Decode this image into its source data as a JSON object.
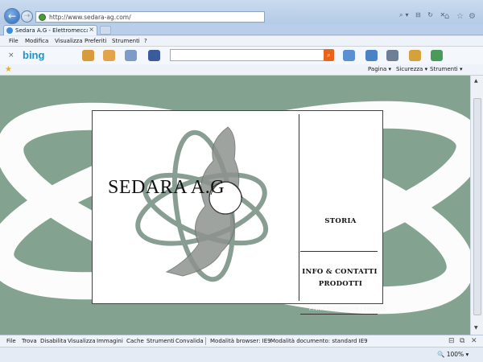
{
  "browser": {
    "url": "http://www.sedara-ag.com/",
    "tab_title": "Sedara A.G - Elettromeccan...",
    "tab_close": "×",
    "back_glyph": "←",
    "forward_glyph": "→",
    "addr_icons": "⌕▾ ⊟ ↻ ✕",
    "window_buttons": [
      "⌂",
      "☆",
      "⚙"
    ],
    "menu": [
      "File",
      "Modifica",
      "Visualizza",
      "Preferiti",
      "Strumenti",
      "?"
    ],
    "bing_logo": "bing",
    "bing_close": "×",
    "bing_go": "⌕",
    "command_bar": [
      "Pagina ▾",
      "Sicurezza ▾",
      "Strumenti ▾"
    ],
    "fav_icon": "star-icon",
    "scroll_up": "▲",
    "scroll_down": "▼"
  },
  "page": {
    "brand": "SEDARA A.G",
    "nav": [
      "STORIA",
      "PRODOTTI",
      "INFO & CONTATTI"
    ],
    "footer": "P.IVA 03324800139 | CREDITS",
    "colors": {
      "background": "#83a390",
      "accent_gray": "#7d8e86",
      "panel": "#ffffff",
      "swoosh": "#ffffff"
    }
  },
  "devtools_bar": {
    "items": [
      "File",
      "Trova",
      "Disabilita",
      "Visualizza",
      "Immagini",
      "Cache",
      "Strumenti",
      "Convalida",
      "Modalità browser: IE9",
      "Modalità documento: standard IE9"
    ]
  },
  "status": {
    "zoom": "🔍 100% ▾"
  }
}
